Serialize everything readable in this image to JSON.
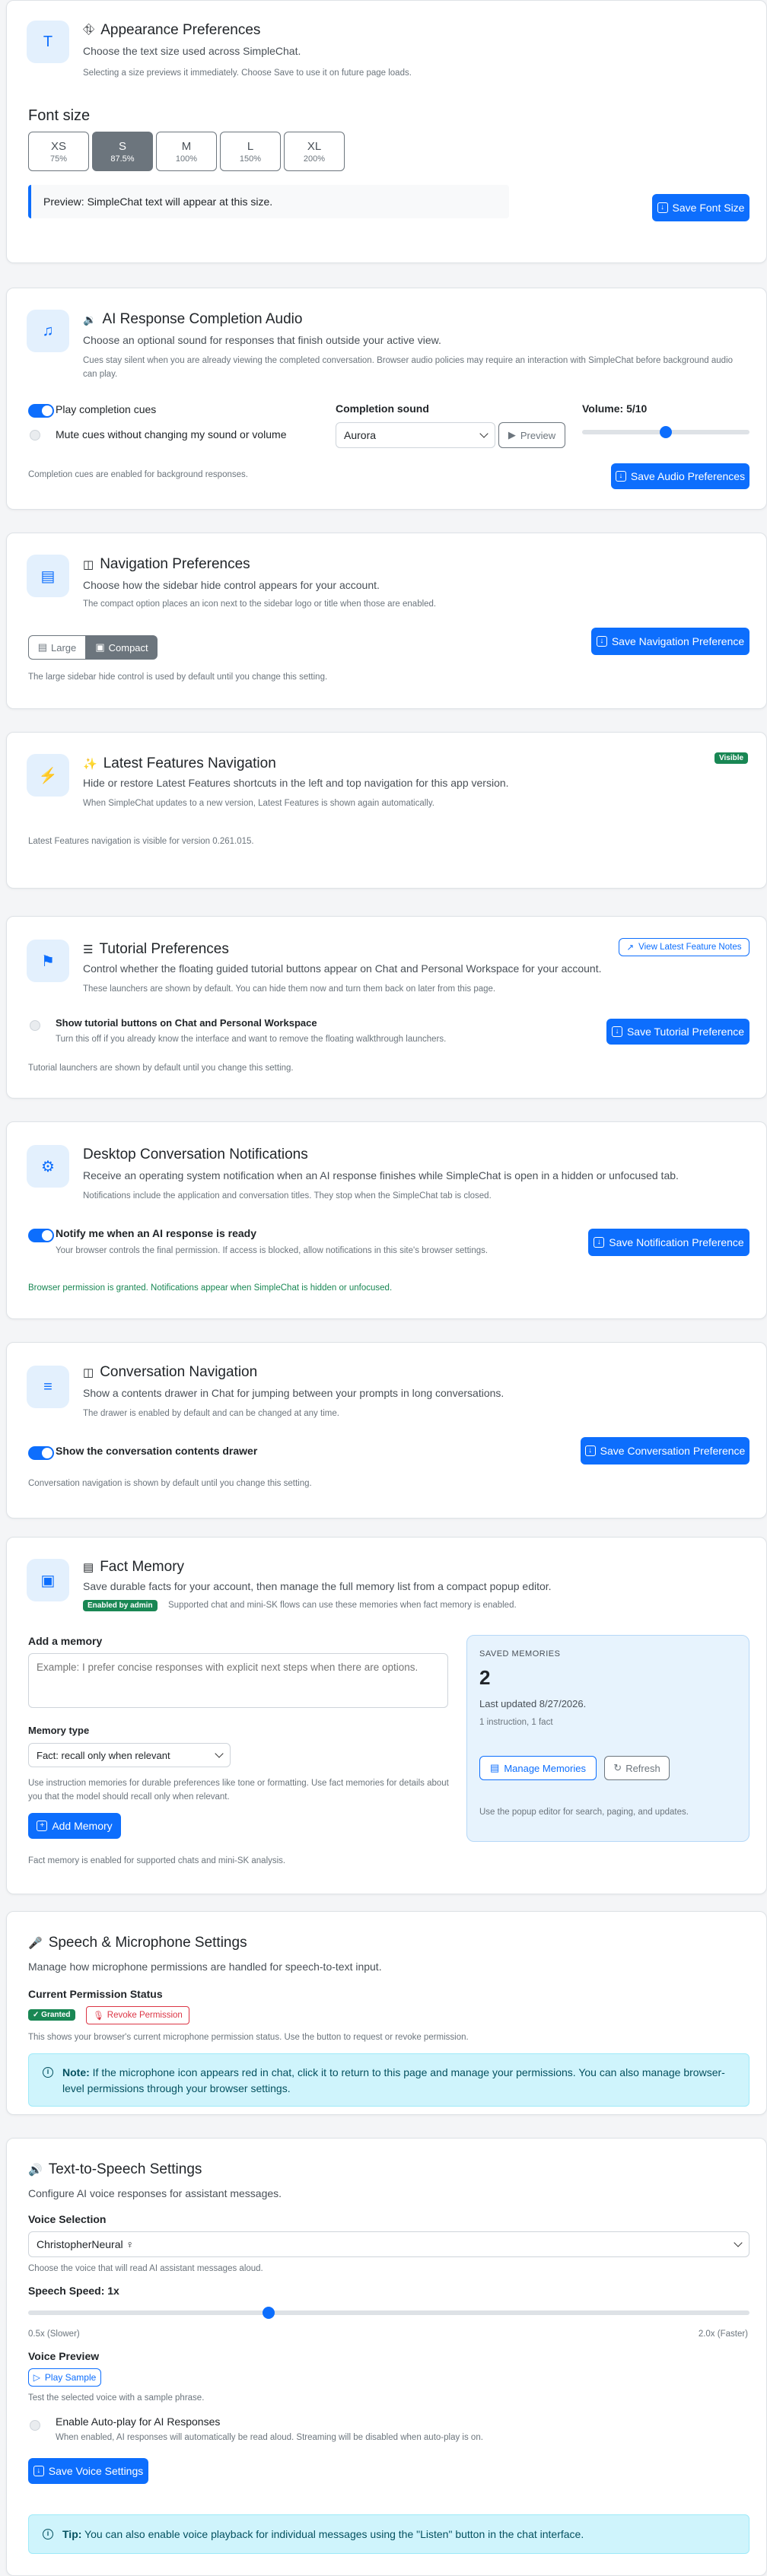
{
  "appearance": {
    "title": "Appearance Preferences",
    "subtitle": "Choose the text size used across SimpleChat.",
    "note": "Selecting a size previews it immediately. Choose Save to use it on future page loads.",
    "font_size_heading": "Font size",
    "sizes": [
      {
        "label": "XS",
        "pct": "75%"
      },
      {
        "label": "S",
        "pct": "87.5%"
      },
      {
        "label": "M",
        "pct": "100%"
      },
      {
        "label": "L",
        "pct": "150%"
      },
      {
        "label": "XL",
        "pct": "200%"
      }
    ],
    "selected": "S",
    "preview": "Preview: SimpleChat text will appear at this size.",
    "save_label": "Save Font Size"
  },
  "audio": {
    "title": "AI Response Completion Audio",
    "subtitle": "Choose an optional sound for responses that finish outside your active view.",
    "note": "Cues stay silent when you are already viewing the completed conversation. Browser audio policies may require an interaction with SimpleChat before background audio can play.",
    "play_cues_label": "Play completion cues",
    "play_cues_on": true,
    "mute_label": "Mute cues without changing my sound or volume",
    "mute_on": false,
    "sound_heading": "Completion sound",
    "sound_value": "Aurora",
    "preview_label": "Preview",
    "volume_label": "Volume: 5/10",
    "volume_value": 5,
    "volume_max": 10,
    "status": "Completion cues are enabled for background responses.",
    "save_label": "Save Audio Preferences"
  },
  "navigation": {
    "title": "Navigation Preferences",
    "subtitle": "Choose how the sidebar hide control appears for your account.",
    "note": "The compact option places an icon next to the sidebar logo or title when those are enabled.",
    "large_label": "Large",
    "compact_label": "Compact",
    "selected": "Compact",
    "status": "The large sidebar hide control is used by default until you change this setting.",
    "save_label": "Save Navigation Preference"
  },
  "latest": {
    "title": "Latest Features Navigation",
    "badge": "Visible",
    "subtitle": "Hide or restore Latest Features shortcuts in the left and top navigation for this app version.",
    "note": "When SimpleChat updates to a new version, Latest Features is shown again automatically.",
    "status": "Latest Features navigation is visible for version 0.261.015."
  },
  "tutorial": {
    "title": "Tutorial Preferences",
    "subtitle": "Control whether the floating guided tutorial buttons appear on Chat and Personal Workspace for your account.",
    "note": "These launchers are shown by default. You can hide them now and turn them back on later from this page.",
    "view_notes_label": "View Latest Feature Notes",
    "toggle_label": "Show tutorial buttons on Chat and Personal Workspace",
    "toggle_note": "Turn this off if you already know the interface and want to remove the floating walkthrough launchers.",
    "toggle_on": false,
    "status": "Tutorial launchers are shown by default until you change this setting.",
    "save_label": "Save Tutorial Preference"
  },
  "desktop_notif": {
    "title": "Desktop Conversation Notifications",
    "subtitle": "Receive an operating system notification when an AI response finishes while SimpleChat is open in a hidden or unfocused tab.",
    "note": "Notifications include the application and conversation titles. They stop when the SimpleChat tab is closed.",
    "toggle_label": "Notify me when an AI response is ready",
    "toggle_note": "Your browser controls the final permission. If access is blocked, allow notifications in this site's browser settings.",
    "toggle_on": true,
    "status": "Browser permission is granted. Notifications appear when SimpleChat is hidden or unfocused.",
    "save_label": "Save Notification Preference"
  },
  "conv_nav": {
    "title": "Conversation Navigation",
    "subtitle": "Show a contents drawer in Chat for jumping between your prompts in long conversations.",
    "note": "The drawer is enabled by default and can be changed at any time.",
    "toggle_label": "Show the conversation contents drawer",
    "toggle_on": true,
    "status": "Conversation navigation is shown by default until you change this setting.",
    "save_label": "Save Conversation Preference"
  },
  "fact_memory": {
    "title": "Fact Memory",
    "subtitle": "Save durable facts for your account, then manage the full memory list from a compact popup editor.",
    "badge": "Enabled by admin",
    "badge_note": "Supported chat and mini-SK flows can use these memories when fact memory is enabled.",
    "add_heading": "Add a memory",
    "textarea_placeholder": "Example: I prefer concise responses with explicit next steps when there are options.",
    "type_heading": "Memory type",
    "type_value": "Fact: recall only when relevant",
    "type_note": "Use instruction memories for durable preferences like tone or formatting. Use fact memories for details about you that the model should recall only when relevant.",
    "add_label": "Add Memory",
    "status": "Fact memory is enabled for supported chats and mini-SK analysis.",
    "saved_heading": "SAVED MEMORIES",
    "saved_count": "2",
    "last_updated": "Last updated 8/27/2026.",
    "counts": "1 instruction, 1 fact",
    "manage_label": "Manage Memories",
    "refresh_label": "Refresh",
    "popup_note": "Use the popup editor for search, paging, and updates."
  },
  "speech": {
    "title": "Speech & Microphone Settings",
    "subtitle": "Manage how microphone permissions are handled for speech-to-text input.",
    "status_heading": "Current Permission Status",
    "granted_badge": "Granted",
    "revoke_label": "Revoke Permission",
    "status_note": "This shows your browser's current microphone permission status. Use the button to request or revoke permission.",
    "note_bold": "Note:",
    "note_text": "If the microphone icon appears red in chat, click it to return to this page and manage your permissions. You can also manage browser-level permissions through your browser settings."
  },
  "tts": {
    "title": "Text-to-Speech Settings",
    "subtitle": "Configure AI voice responses for assistant messages.",
    "voice_heading": "Voice Selection",
    "voice_value": "ChristopherNeural ♀",
    "voice_note": "Choose the voice that will read AI assistant messages aloud.",
    "speed_heading": "Speech Speed: 1x",
    "speed_value": 1.0,
    "speed_min": 0.5,
    "speed_max": 2.0,
    "speed_min_label": "0.5x (Slower)",
    "speed_max_label": "2.0x (Faster)",
    "preview_heading": "Voice Preview",
    "play_label": "Play Sample",
    "preview_note": "Test the selected voice with a sample phrase.",
    "autoplay_label": "Enable Auto-play for AI Responses",
    "autoplay_note": "When enabled, AI responses will automatically be read aloud. Streaming will be disabled when auto-play is on.",
    "autoplay_on": false,
    "save_label": "Save Voice Settings",
    "tip_bold": "Tip:",
    "tip_text": "You can also enable voice playback for individual messages using the \"Listen\" button in the chat interface."
  },
  "colors": {
    "primary": "#0d6efd",
    "success": "#198754",
    "danger": "#dc3545",
    "info_bg": "#cff4fc"
  }
}
